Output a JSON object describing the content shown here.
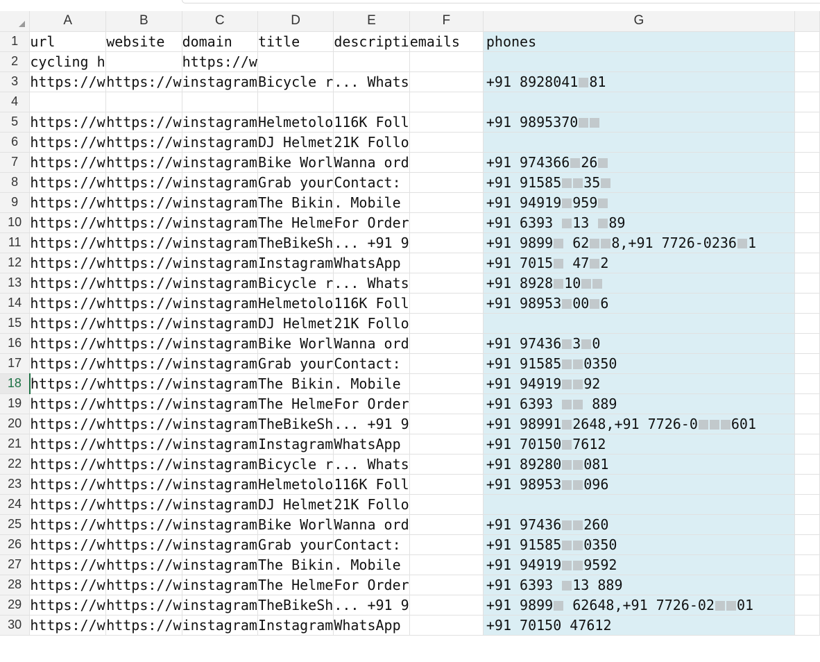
{
  "columns": [
    "A",
    "B",
    "C",
    "D",
    "E",
    "F",
    "G"
  ],
  "headers": {
    "A": "url",
    "B": "website",
    "C": "domain",
    "D": "title",
    "E": "descripti",
    "F": "emails",
    "G": "phones"
  },
  "rows": [
    {
      "n": "2",
      "a": "cycling h",
      "b": "",
      "c": "https://w",
      "d": "",
      "e": "",
      "f": "",
      "g": ""
    },
    {
      "n": "3",
      "a": "https://w",
      "b": "https://w",
      "c": "instagram",
      "d": "Bicycle r",
      "e": "... Whats",
      "f": "",
      "g": "+91 8928041█81"
    },
    {
      "n": "4",
      "a": "",
      "b": "",
      "c": "",
      "d": "",
      "e": "",
      "f": "",
      "g": ""
    },
    {
      "n": "5",
      "a": "https://w",
      "b": "https://w",
      "c": "instagram",
      "d": "Helmetolo",
      "e": "116K Foll",
      "f": "",
      "g": "+91 9895370██"
    },
    {
      "n": "6",
      "a": "https://w",
      "b": "https://w",
      "c": "instagram",
      "d": "DJ Helmet",
      "e": "21K Follo",
      "f": "",
      "g": ""
    },
    {
      "n": "7",
      "a": "https://w",
      "b": "https://w",
      "c": "instagram",
      "d": "Bike Worl",
      "e": "Wanna ord",
      "f": "",
      "g": "+91 974366█26█"
    },
    {
      "n": "8",
      "a": "https://w",
      "b": "https://w",
      "c": "instagram",
      "d": "Grab your",
      "e": "Contact: ",
      "f": "",
      "g": "+91 91585██35█"
    },
    {
      "n": "9",
      "a": "https://w",
      "b": "https://w",
      "c": "instagram",
      "d": "The Bikin",
      "e": ". Mobile ",
      "f": "",
      "g": "+91 94919█959█"
    },
    {
      "n": "10",
      "a": "https://w",
      "b": "https://w",
      "c": "instagram",
      "d": "The Helme",
      "e": "For Order",
      "f": "",
      "g": "+91 6393 █13 █89"
    },
    {
      "n": "11",
      "a": "https://w",
      "b": "https://w",
      "c": "instagram",
      "d": "TheBikeSh",
      "e": "... +91 9",
      "f": "",
      "g": "+91 9899█ 62██8,+91 7726-0236█1"
    },
    {
      "n": "12",
      "a": "https://w",
      "b": "https://w",
      "c": "instagram",
      "d": "Instagram",
      "e": "WhatsApp ",
      "f": "",
      "g": "+91 7015█ 47█2"
    },
    {
      "n": "13",
      "a": "https://w",
      "b": "https://w",
      "c": "instagram",
      "d": "Bicycle r",
      "e": "... Whats",
      "f": "",
      "g": "+91 8928█10██"
    },
    {
      "n": "14",
      "a": "https://w",
      "b": "https://w",
      "c": "instagram",
      "d": "Helmetolo",
      "e": "116K Foll",
      "f": "",
      "g": "+91 98953█00█6"
    },
    {
      "n": "15",
      "a": "https://w",
      "b": "https://w",
      "c": "instagram",
      "d": "DJ Helmet",
      "e": "21K Follo",
      "f": "",
      "g": ""
    },
    {
      "n": "16",
      "a": "https://w",
      "b": "https://w",
      "c": "instagram",
      "d": "Bike Worl",
      "e": "Wanna ord",
      "f": "",
      "g": "+91 97436█3█0"
    },
    {
      "n": "17",
      "a": "https://w",
      "b": "https://w",
      "c": "instagram",
      "d": "Grab your",
      "e": "Contact: ",
      "f": "",
      "g": "+91 91585██0350"
    },
    {
      "n": "18",
      "a": "https://w",
      "b": "https://w",
      "c": "instagram",
      "d": "The Bikin",
      "e": ". Mobile ",
      "f": "",
      "g": "+91 94919██92"
    },
    {
      "n": "19",
      "a": "https://w",
      "b": "https://w",
      "c": "instagram",
      "d": "The Helme",
      "e": "For Order",
      "f": "",
      "g": "+91 6393 ██ 889"
    },
    {
      "n": "20",
      "a": "https://w",
      "b": "https://w",
      "c": "instagram",
      "d": "TheBikeSh",
      "e": "... +91 9",
      "f": "",
      "g": "+91 98991█2648,+91 7726-0███601"
    },
    {
      "n": "21",
      "a": "https://w",
      "b": "https://w",
      "c": "instagram",
      "d": "Instagram",
      "e": "WhatsApp ",
      "f": "",
      "g": "+91 70150█7612"
    },
    {
      "n": "22",
      "a": "https://w",
      "b": "https://w",
      "c": "instagram",
      "d": "Bicycle r",
      "e": "... Whats",
      "f": "",
      "g": "+91 89280██081"
    },
    {
      "n": "23",
      "a": "https://w",
      "b": "https://w",
      "c": "instagram",
      "d": "Helmetolo",
      "e": "116K Foll",
      "f": "",
      "g": "+91 98953██096"
    },
    {
      "n": "24",
      "a": "https://w",
      "b": "https://w",
      "c": "instagram",
      "d": "DJ Helmet",
      "e": "21K Follo",
      "f": "",
      "g": ""
    },
    {
      "n": "25",
      "a": "https://w",
      "b": "https://w",
      "c": "instagram",
      "d": "Bike Worl",
      "e": "Wanna ord",
      "f": "",
      "g": "+91 97436██260"
    },
    {
      "n": "26",
      "a": "https://w",
      "b": "https://w",
      "c": "instagram",
      "d": "Grab your",
      "e": "Contact: ",
      "f": "",
      "g": "+91 91585██0350"
    },
    {
      "n": "27",
      "a": "https://w",
      "b": "https://w",
      "c": "instagram",
      "d": "The Bikin",
      "e": ". Mobile ",
      "f": "",
      "g": "+91 94919██9592"
    },
    {
      "n": "28",
      "a": "https://w",
      "b": "https://w",
      "c": "instagram",
      "d": "The Helme",
      "e": "For Order",
      "f": "",
      "g": "+91 6393 █13 889"
    },
    {
      "n": "29",
      "a": "https://w",
      "b": "https://w",
      "c": "instagram",
      "d": "TheBikeSh",
      "e": "... +91 9",
      "f": "",
      "g": "+91 9899█ 62648,+91 7726-02██01"
    },
    {
      "n": "30",
      "a": "https://w",
      "b": "https://w",
      "c": "instagram",
      "d": "Instagram",
      "e": "WhatsApp ",
      "f": "",
      "g": "+91 70150 47612"
    }
  ],
  "active_row": "18",
  "colors": {
    "phones_fill": "#dbeef4",
    "header_bg": "#f3f3f3",
    "active_row_label": "#1e7145"
  }
}
